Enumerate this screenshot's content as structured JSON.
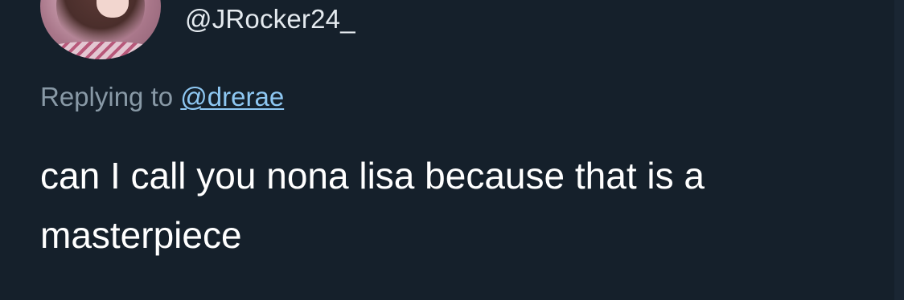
{
  "tweet": {
    "handle": "@JRocker24_",
    "replying_prefix": "Replying to",
    "replying_to": "@drerae",
    "text": "can I call you nona lisa because that is a masterpiece"
  },
  "colors": {
    "background": "#15202b",
    "text": "#ffffff",
    "secondary_text": "#8899a6",
    "link": "#8ec7f2"
  }
}
